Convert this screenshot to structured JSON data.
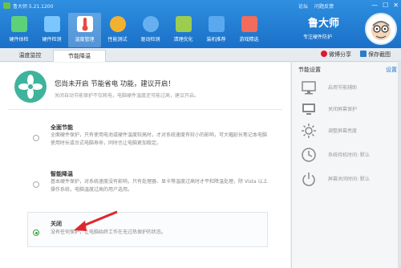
{
  "app": {
    "title": "鲁大师 5.21.1200",
    "top_links": [
      "论坛",
      "问题反馈"
    ],
    "window_controls": [
      "—",
      "☐",
      "✕"
    ]
  },
  "nav": [
    {
      "label": "硬件体检",
      "icon": "hardware-check-icon",
      "color": "#5fd07a"
    },
    {
      "label": "硬件检测",
      "icon": "hardware-detect-icon",
      "color": "#7cc6ff"
    },
    {
      "label": "温度管理",
      "icon": "thermometer-icon",
      "color": "#e84a3c"
    },
    {
      "label": "性能测试",
      "icon": "speedometer-icon",
      "color": "#f2b230"
    },
    {
      "label": "驱动检测",
      "icon": "driver-icon",
      "color": "#66b0f0"
    },
    {
      "label": "清理优化",
      "icon": "broom-icon",
      "color": "#9ccc50"
    },
    {
      "label": "装机推荐",
      "icon": "computer-icon",
      "color": "#5aa9ef"
    },
    {
      "label": "游戏精选",
      "icon": "gamepad-icon",
      "color": "#f26b5b"
    }
  ],
  "brand": {
    "name": "鲁大师",
    "slogan": "专注硬件防护"
  },
  "subtabs": [
    "温度监控",
    "节能降温"
  ],
  "share": [
    "微博分享",
    "保存截图"
  ],
  "banner": {
    "title": "您尚未开启 节能省电 功能，建议开启！",
    "subtitle": "关闭自动节能保护不仅耗电，电脑硬件温度还可能过高，建议开启。"
  },
  "options": [
    {
      "title": "全面节能",
      "desc": "全面硬件保护，只有使用电池或硬件温度较高时，才对系统速度有较小的影响，可大幅延长笔记本电脑使用时长或台式电脑寿命，同时也让电脑更加稳定。",
      "selected": false
    },
    {
      "title": "智能降温",
      "desc": "基本硬件保护，对系统速度没有影响，只有处理器、显卡等温度过高时才平和降温处理，除 Vista 以上操作系统，电脑温度过高的用户选用。",
      "selected": false
    },
    {
      "title": "关闭",
      "desc": "没有任何保护，让电脑始终工作在无过热保护的状态。",
      "selected": true
    }
  ],
  "side": {
    "title": "节能设置",
    "link": "设置",
    "items": [
      {
        "label": "启用节能辅助",
        "icon": "monitor-icon"
      },
      {
        "label": "关闭屏幕保护",
        "icon": "screen-icon"
      },
      {
        "label": "调整屏幕亮度",
        "icon": "brightness-icon"
      },
      {
        "label": "系统待机时间: 默认",
        "icon": "clock-icon"
      },
      {
        "label": "屏幕关闭时间: 默认",
        "icon": "power-icon"
      }
    ]
  },
  "colors": {
    "header": "#2b86d8",
    "accent_green": "#3aa23a",
    "arrow_red": "#e0262d"
  }
}
